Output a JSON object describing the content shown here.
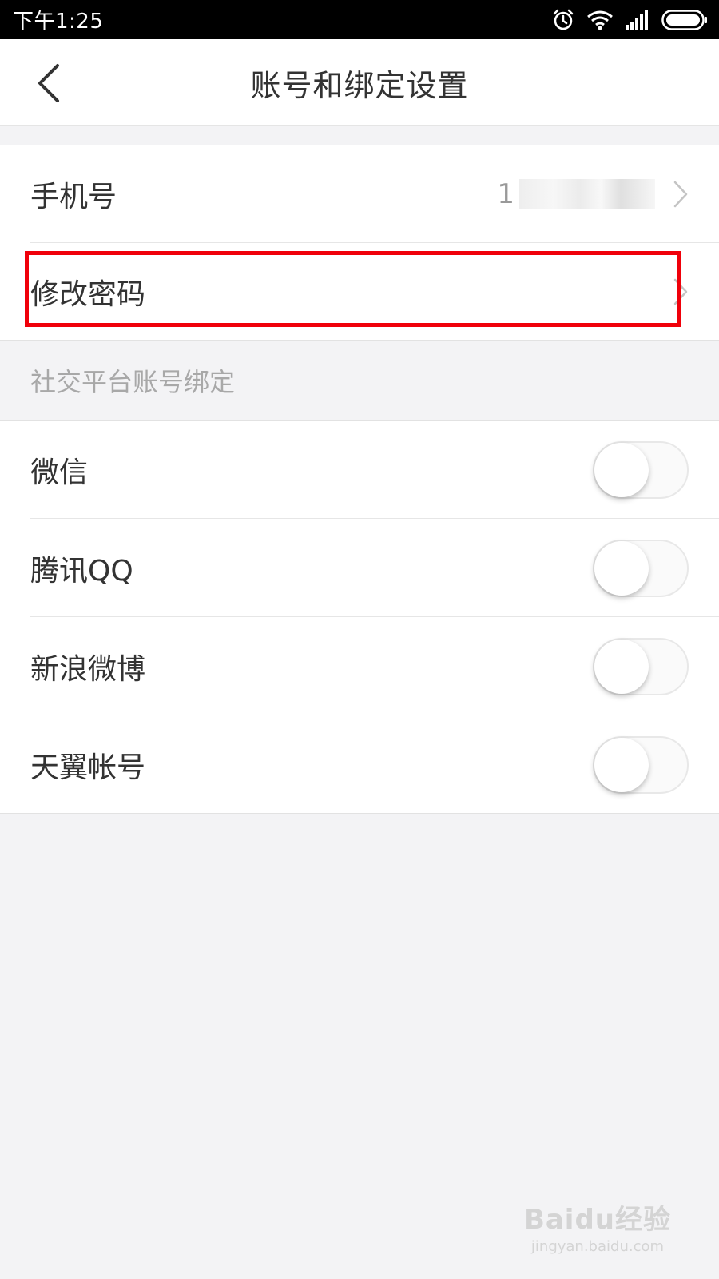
{
  "status_bar": {
    "time": "下午1:25",
    "icons": [
      "alarm-icon",
      "wifi-icon",
      "signal-icon",
      "battery-icon"
    ]
  },
  "header": {
    "title": "账号和绑定设置",
    "back_icon": "chevron-left-icon"
  },
  "account_section": {
    "rows": [
      {
        "label": "手机号",
        "value": "1",
        "value_obscured": true
      },
      {
        "label": "修改密码"
      }
    ]
  },
  "social_section": {
    "header": "社交平台账号绑定",
    "rows": [
      {
        "label": "微信",
        "enabled": false
      },
      {
        "label": "腾讯QQ",
        "enabled": false
      },
      {
        "label": "新浪微博",
        "enabled": false
      },
      {
        "label": "天翼帐号",
        "enabled": false
      }
    ]
  },
  "annotation": {
    "highlight_color": "#f0000a",
    "highlighted_item": "修改密码"
  },
  "watermark": {
    "main": "Baidu经验",
    "sub": "jingyan.baidu.com"
  },
  "colors": {
    "page_background": "#f3f3f5",
    "status_bar": "#000000",
    "text_primary": "#333333",
    "text_secondary": "#a8a8a8"
  }
}
